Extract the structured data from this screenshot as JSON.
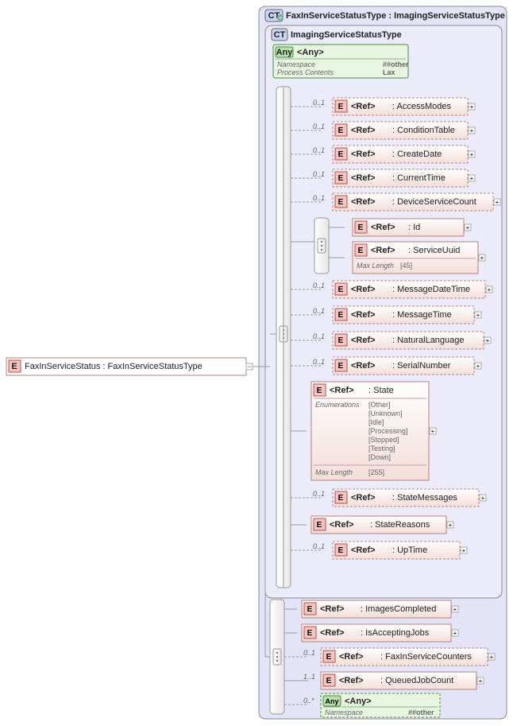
{
  "root": {
    "icon": "E",
    "label": "FaxInServiceStatus : FaxInServiceStatusType"
  },
  "ctOuter": {
    "icon": "CT",
    "label": "FaxInServiceStatusType : ImagingServiceStatusType"
  },
  "ctInner": {
    "icon": "CT",
    "label": "ImagingServiceStatusType"
  },
  "any1": {
    "icon": "Any",
    "title": "<Any>",
    "nsLabel": "Namespace",
    "nsVal": "##other",
    "pcLabel": "Process Contents",
    "pcVal": "Lax"
  },
  "seqInner": {
    "card1": "0..1",
    "card2": "0..1",
    "card3": "0..1",
    "card4": "0..1",
    "card5": "0..1",
    "card6": "",
    "card7": "0..1",
    "card8": "0..1",
    "card9": "0..1",
    "card10": "0..1",
    "card11": "",
    "card12": "0..1",
    "card13": "",
    "card14": "0..1"
  },
  "refs": {
    "accessModes": {
      "title": "<Ref>",
      "name": ": AccessModes"
    },
    "conditionTable": {
      "title": "<Ref>",
      "name": ": ConditionTable"
    },
    "createDate": {
      "title": "<Ref>",
      "name": ": CreateDate"
    },
    "currentTime": {
      "title": "<Ref>",
      "name": ": CurrentTime"
    },
    "deviceServiceCount": {
      "title": "<Ref>",
      "name": ": DeviceServiceCount"
    },
    "id": {
      "title": "<Ref>",
      "name": ": Id"
    },
    "serviceUuid": {
      "title": "<Ref>",
      "name": ": ServiceUuid",
      "maxLenLabel": "Max Length",
      "maxLenVal": "[45]"
    },
    "messageDateTime": {
      "title": "<Ref>",
      "name": ": MessageDateTime"
    },
    "messageTime": {
      "title": "<Ref>",
      "name": ": MessageTime"
    },
    "naturalLanguage": {
      "title": "<Ref>",
      "name": ": NaturalLanguage"
    },
    "serialNumber": {
      "title": "<Ref>",
      "name": ": SerialNumber"
    },
    "state": {
      "title": "<Ref>",
      "name": ": State",
      "enumLabel": "Enumerations",
      "enums": [
        "[Other]",
        "[Unknown]",
        "[Idle]",
        "[Processing]",
        "[Stopped]",
        "[Testing]",
        "[Down]"
      ],
      "maxLenLabel": "Max Length",
      "maxLenVal": "[255]"
    },
    "stateMessages": {
      "title": "<Ref>",
      "name": ": StateMessages"
    },
    "stateReasons": {
      "title": "<Ref>",
      "name": ": StateReasons"
    },
    "upTime": {
      "title": "<Ref>",
      "name": ": UpTime"
    },
    "imagesCompleted": {
      "title": "<Ref>",
      "name": ": ImagesCompleted"
    },
    "isAcceptingJobs": {
      "title": "<Ref>",
      "name": ": IsAcceptingJobs"
    },
    "faxInServiceCounters": {
      "title": "<Ref>",
      "name": ": FaxInServiceCounters"
    },
    "queuedJobCount": {
      "title": "<Ref>",
      "name": ": QueuedJobCount"
    }
  },
  "seqOuter": {
    "card1": "",
    "card2": "",
    "card3": "0..1",
    "card4": "1..1",
    "card5": "0..*"
  },
  "any2": {
    "icon": "Any",
    "title": "<Any>",
    "nsLabel": "Namespace",
    "nsVal": "##other"
  }
}
